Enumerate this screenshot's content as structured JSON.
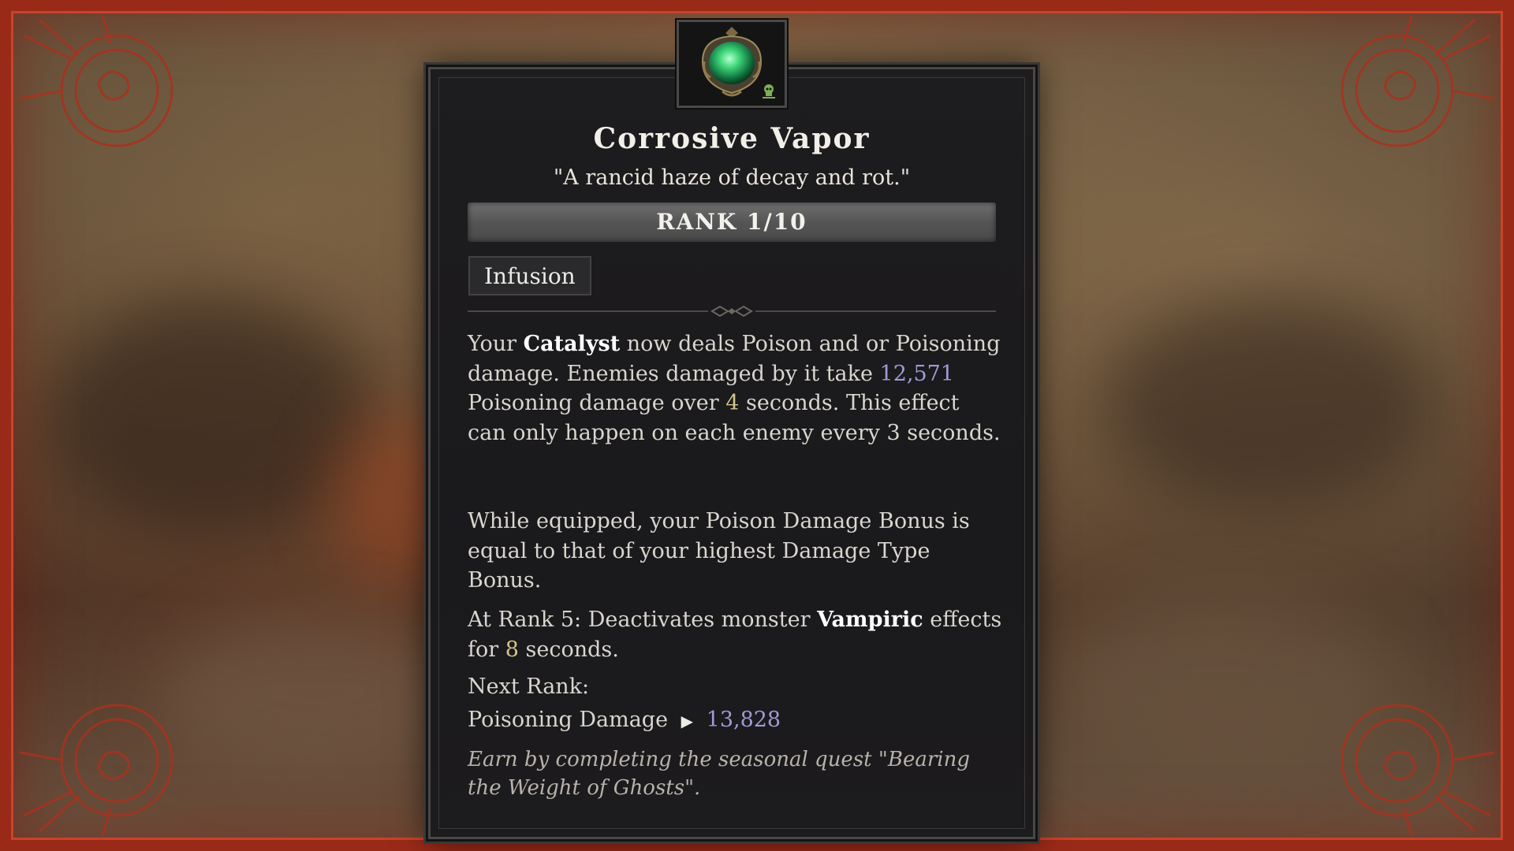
{
  "tooltip": {
    "title": "Corrosive Vapor",
    "flavor": "\"A rancid haze of decay and rot.\"",
    "rank": "RANK 1/10",
    "tag": "Infusion",
    "desc1": {
      "p1": "Your ",
      "catalyst": "Catalyst",
      "p2": " now deals Poison and or Poisoning damage. Enemies damaged by it take ",
      "damage": "12,571",
      "p3": " Poisoning damage over ",
      "duration": "4",
      "p4": " seconds. This effect can only happen on each enemy every ",
      "cooldown": "3",
      "p5": " seconds."
    },
    "desc2": "While equipped, your Poison Damage Bonus is equal to that of your highest Damage Type Bonus.",
    "rank5": {
      "p1": "At Rank 5: Deactivates monster ",
      "vampiric": "Vampiric",
      "p2": " effects for ",
      "seconds": "8",
      "p3": " seconds."
    },
    "next_rank_label": "Next Rank:",
    "next_rank_stat": "Poisoning Damage",
    "next_rank_arrow": "▶",
    "next_rank_value": "13,828",
    "quest": "Earn by completing the seasonal quest \"Bearing the Weight of Ghosts\"."
  },
  "icons": {
    "aspect": "aspect-gem-icon",
    "poison": "poison-skull-icon"
  },
  "colors": {
    "frame_red": "#9a2a18",
    "number_blue": "#9f9bd6",
    "number_gold": "#d2c58a",
    "panel_bg": "#1d1c1e"
  }
}
